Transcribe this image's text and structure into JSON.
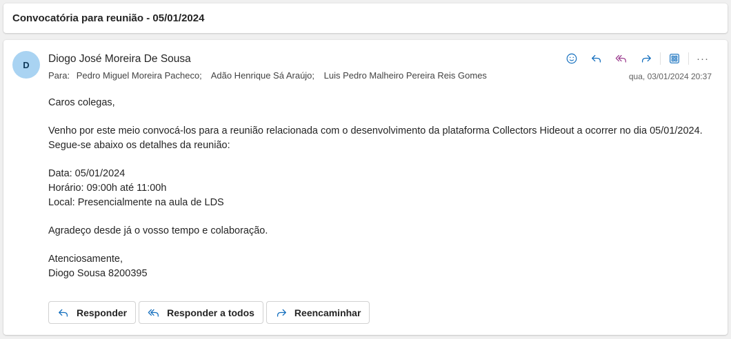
{
  "subject": "Convocatória para reunião - 05/01/2024",
  "sender": {
    "initial": "D",
    "name": "Diogo José Moreira De Sousa"
  },
  "recipients": {
    "to_label": "Para:",
    "list": [
      "Pedro Miguel Moreira Pacheco;",
      "Adão Henrique Sá Araújo;",
      "Luis Pedro Malheiro Pereira Reis Gomes"
    ]
  },
  "timestamp": "qua, 03/01/2024 20:37",
  "toolbar": {
    "more_label": "···"
  },
  "body": {
    "greeting": "Caros colegas,",
    "intro": "Venho por este meio convocá-los para a reunião relacionada com o desenvolvimento da plataforma Collectors Hideout a ocorrer no dia 05/01/2024. Segue-se abaixo os detalhes da reunião:",
    "details": [
      "Data: 05/01/2024",
      "Horário: 09:00h até 11:00h",
      "Local: Presencialmente na aula de LDS"
    ],
    "thanks": "Agradeço desde já o vosso tempo e colaboração.",
    "closing": "Atenciosamente,",
    "signature": "Diogo Sousa 8200395"
  },
  "footer": {
    "reply_label": "Responder",
    "reply_all_label": "Responder a todos",
    "forward_label": "Reencaminhar"
  },
  "colors": {
    "accent": "#0f6cbd",
    "reply_all_icon": "#9c3d8f",
    "avatar_bg": "#a9d3f2"
  }
}
